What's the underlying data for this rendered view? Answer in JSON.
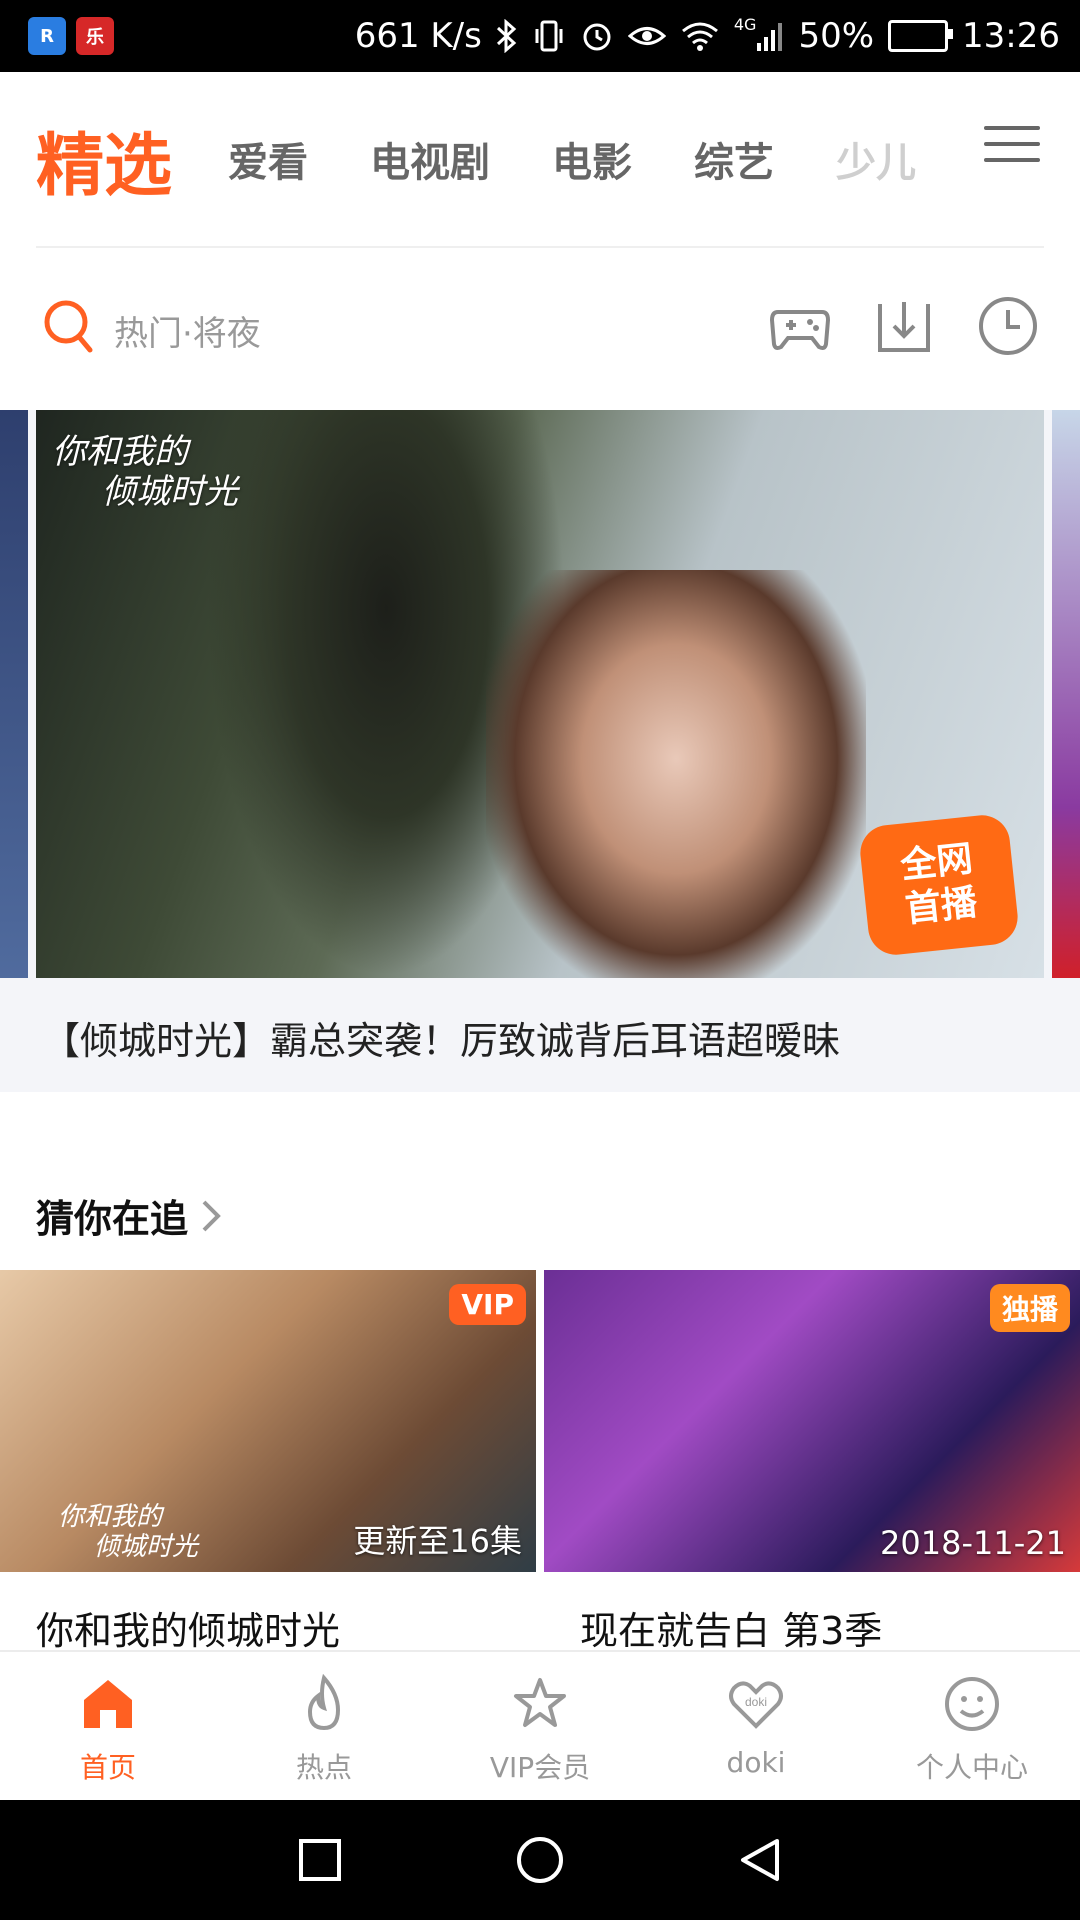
{
  "status_bar": {
    "app_badge_1": "R",
    "app_badge_2": "乐",
    "network_speed": "661 K/s",
    "network_type": "4G",
    "battery": "50%",
    "time": "13:26"
  },
  "top_tabs": [
    {
      "label": "精选",
      "active": true
    },
    {
      "label": "爱看"
    },
    {
      "label": "电视剧"
    },
    {
      "label": "电影"
    },
    {
      "label": "综艺"
    },
    {
      "label": "少儿",
      "faded": true
    }
  ],
  "search": {
    "placeholder": "热门·将夜"
  },
  "banner": {
    "logo_text_line1": "你和我的",
    "logo_text_line2": "倾城时光",
    "badge_line1": "全网",
    "badge_line2": "首播",
    "caption": "【倾城时光】霸总突袭！厉致诚背后耳语超暧昧"
  },
  "section": {
    "title": "猜你在追"
  },
  "cards": [
    {
      "badge": "VIP",
      "overlay": "更新至16集",
      "logo_line1": "你和我的",
      "logo_line2": "倾城时光",
      "title": "你和我的倾城时光"
    },
    {
      "badge": "独播",
      "overlay": "2018-11-21",
      "title": "现在就告白 第3季"
    }
  ],
  "bottom_nav": [
    {
      "label": "首页",
      "icon": "home-icon",
      "active": true
    },
    {
      "label": "热点",
      "icon": "flame-icon"
    },
    {
      "label": "VIP会员",
      "icon": "vip-star-icon"
    },
    {
      "label": "doki",
      "icon": "doki-heart-icon"
    },
    {
      "label": "个人中心",
      "icon": "smiley-icon"
    }
  ],
  "colors": {
    "accent": "#ff6022",
    "badge_orange": "#ff8a1f"
  }
}
